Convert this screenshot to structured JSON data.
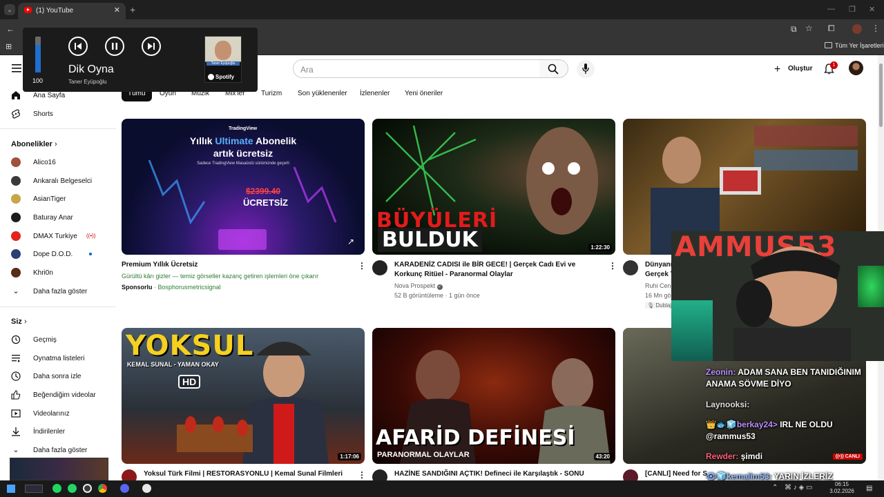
{
  "browser": {
    "tab_title": "(1) YouTube",
    "tab_close": "✕",
    "new_tab": "+",
    "bookmarks_label": "Tüm Yer İşaretleri"
  },
  "media_popup": {
    "volume": "100",
    "volume_level": 0.77,
    "track": "Dik Oyna",
    "artist": "Taner Eyüpoğlu",
    "source": "Spotify",
    "album_caption": "Taner Eyüpoğlu"
  },
  "youtube": {
    "search_placeholder": "Ara",
    "create_label": "Oluştur",
    "notification_count": "1",
    "chips": [
      "Tümü",
      "Oyun",
      "Müzik",
      "Mix'ler",
      "Turizm",
      "Son yüklenenler",
      "İzlenenler",
      "Yeni öneriler"
    ],
    "sidebar": {
      "home": "Ana Sayfa",
      "shorts": "Shorts",
      "subs_title": "Abonelikler",
      "subscriptions": [
        {
          "name": "Alico16",
          "color": "#a0523d",
          "live": false
        },
        {
          "name": "Ankaralı Belgeselci",
          "color": "#3a3a3a",
          "live": false
        },
        {
          "name": "AsianTiger",
          "color": "#c7a64a",
          "live": false
        },
        {
          "name": "Baturay Anar",
          "color": "#1c1c1c",
          "live": false
        },
        {
          "name": "DMAX Turkiye",
          "color": "#e2241b",
          "live": true
        },
        {
          "name": "Dope D.O.D.",
          "color": "#2d3f73",
          "live": false,
          "dot": true
        },
        {
          "name": "Khri0n",
          "color": "#5a2a1a",
          "live": false
        }
      ],
      "show_more": "Daha fazla göster",
      "you_title": "Siz",
      "you_items": [
        "Geçmiş",
        "Oynatma listeleri",
        "Daha sonra izle",
        "Beğendiğim videolar",
        "Videolarınız",
        "İndirilenler",
        "Daha fazla göster"
      ]
    },
    "videos": [
      {
        "title": "Premium Yıllık Ücretsiz",
        "desc": "Gürültü kârı gizler — temiz görseller kazanç getiren işlemleri öne çıkarır",
        "sponsor_label": "Sponsorlu",
        "sponsor": "Bosphorusmetricsignal",
        "thumb_brand": "TradingView",
        "thumb_line1": "Yıllık ",
        "thumb_highlight": "Ultimate",
        "thumb_line1b": " Abonelik",
        "thumb_line2": "artık ücretsiz",
        "thumb_sub": "Sadece TradingView Masaüstü sürümünde geçerli",
        "thumb_price": "$2399.40",
        "thumb_free": "ÜCRETSİZ"
      },
      {
        "title": "KARADENİZ CADISI ile BİR GECE! | Gerçek Cadı Evi ve Korkunç Ritüel - Paranormal Olaylar",
        "channel": "Nova Prospekt",
        "meta": "52 B görüntüleme · 1 gün önce",
        "duration": "1:22:30",
        "thumb_line1": "BÜYÜLERİ",
        "thumb_line2": "BULDUK"
      },
      {
        "title": "Dünyanı",
        "title2": "Gerçek Y",
        "channel": "Ruhi Cenet",
        "meta": "16 Mn gö",
        "badge": "Dublaj"
      },
      {
        "title": "Yoksul Türk Filmi | RESTORASYONLU | Kemal Sunal Filmleri",
        "duration": "1:17:06",
        "thumb_line1": "YOKSUL",
        "thumb_line2": "KEMAL SUNAL - YAMAN OKAY",
        "thumb_hd": "HD"
      },
      {
        "title": "HAZİNE SANDIĞINI AÇTIK! Defineci ile Karşılaştık - SONU",
        "duration": "43:20",
        "thumb_line1": "AFARİD DEFİNESİ",
        "thumb_line2": "PARANORMAL OLAYLAR"
      },
      {
        "title": "[CANLI] Need for S",
        "live_badge": "CANLI"
      }
    ]
  },
  "stream_overlay": {
    "cam_text": "AMMUS53",
    "chat": [
      {
        "user": "Zeonin:",
        "user_color": "#b98cff",
        "text": "ADAM SANA BEN TANIDIĞINIM ANAMA SÖVME DİYO"
      },
      {
        "user": "Laynooksi:",
        "user_color": "#e0e0e0",
        "text": ""
      },
      {
        "user": "👑🐟🧊berkay24>",
        "user_color": "#b98cff",
        "text": "IRL NE OLDU @rammus53"
      },
      {
        "user": "Rewder:",
        "user_color": "#ff5b7a",
        "text": "şimdi"
      },
      {
        "user": "👁🧊kemalim53:",
        "user_color": "#8fb8ff",
        "text": "YARIN İZLERİZ"
      }
    ]
  },
  "taskbar": {
    "time": "06:15",
    "date": "3.02.2026"
  },
  "colors": {
    "yt_red": "#ff0000",
    "chrome_dark": "#1f1f1f",
    "chrome_toolbar": "#353535",
    "spotify_green": "#1ed760"
  }
}
